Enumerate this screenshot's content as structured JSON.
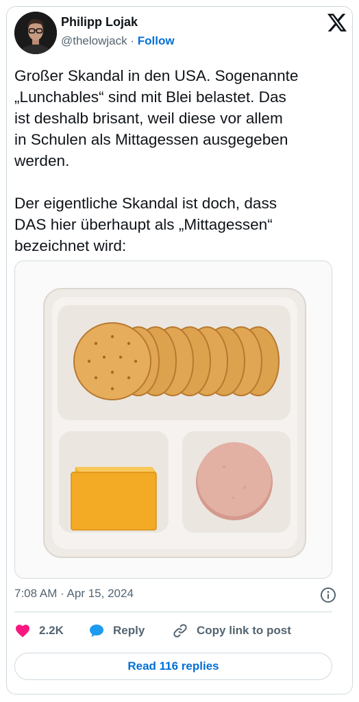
{
  "author": {
    "name": "Philipp Lojak",
    "handle": "@thelowjack",
    "separator": "·",
    "follow_label": "Follow"
  },
  "tweet": {
    "text": "Großer Skandal in den USA. Sogenannte\n„Lunchables“ sind mit Blei belastet. Das\nist deshalb brisant, weil diese vor allem\nin Schulen als Mittagessen ausgegeben\nwerden.\n\nDer eigentliche Skandal ist doch, dass\nDAS hier überhaupt als „Mittagessen“\nbezeichnet wird:",
    "timestamp": "7:08 AM · Apr 15, 2024"
  },
  "actions": {
    "likes": "2.2K",
    "reply_label": "Reply",
    "copy_link_label": "Copy link to post"
  },
  "read_replies_label": "Read 116 replies",
  "icons": {
    "platform": "x-logo-icon",
    "like": "heart-icon",
    "reply": "speech-bubble-icon",
    "copy": "link-icon",
    "info": "info-icon"
  },
  "colors": {
    "link_blue": "#006fd6",
    "heart_pink": "#f91880",
    "reply_blue": "#1d9bf0",
    "muted_text": "#536471",
    "border": "#cfd9de"
  }
}
